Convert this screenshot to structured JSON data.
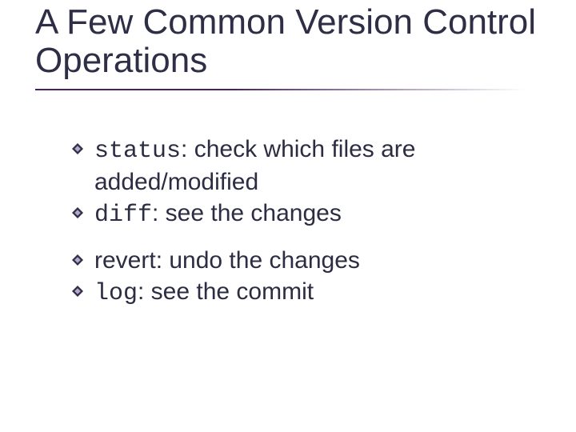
{
  "title": "A Few Common Version Control Operations",
  "items": [
    {
      "cmd": "status",
      "cmd_mono": true,
      "desc": ": check which files are added/modified",
      "gap_before": false
    },
    {
      "cmd": "diff",
      "cmd_mono": true,
      "desc": ": see the changes",
      "gap_before": false
    },
    {
      "cmd": "revert",
      "cmd_mono": false,
      "desc": ": undo the changes",
      "gap_before": true
    },
    {
      "cmd": "log",
      "cmd_mono": true,
      "desc": ": see the commit",
      "gap_before": false
    }
  ]
}
